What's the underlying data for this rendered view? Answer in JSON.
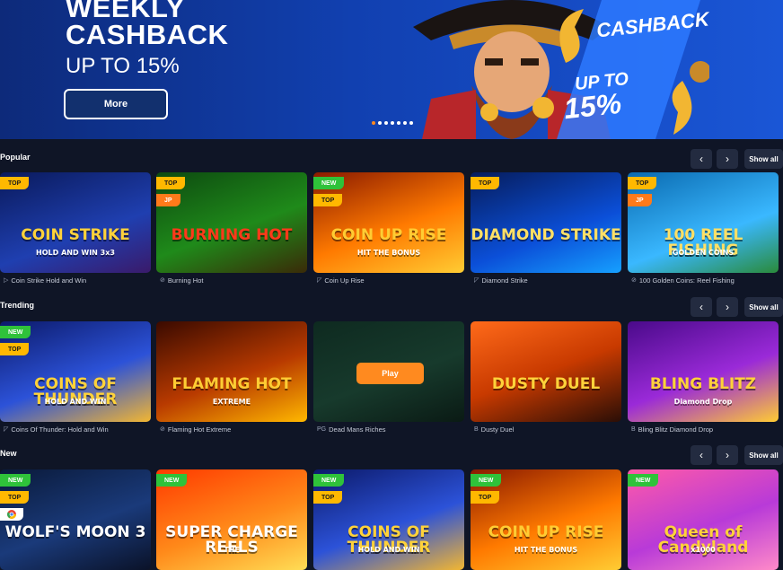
{
  "banner": {
    "title_line1": "WEEKLY",
    "title_line2": "CASHBACK",
    "subtitle": "UP TO 15%",
    "button_label": "More",
    "art_cashback": "CASHBACK",
    "art_upto": "UP TO",
    "art_percent": "15%",
    "slide_count": 7,
    "active_slide": 1
  },
  "nav": {
    "prev_icon": "‹",
    "next_icon": "›",
    "show_all": "Show all"
  },
  "sections": [
    {
      "title": "Popular",
      "games": [
        {
          "name": "Coin Strike Hold and Win",
          "logo": "COIN STRIKE",
          "logo_sub": "HOLD AND WIN 3x3",
          "badges": [
            "TOP"
          ],
          "provider_icon": "playson-icon"
        },
        {
          "name": "Burning Hot",
          "logo": "BURNING HOT",
          "logo_sub": "",
          "badges": [
            "TOP",
            "JP"
          ],
          "provider_icon": "egt-icon"
        },
        {
          "name": "Coin Up Rise",
          "logo": "COIN UP RISE",
          "logo_sub": "HIT THE BONUS",
          "badges": [
            "NEW",
            "TOP"
          ],
          "provider_icon": "3oaks-icon"
        },
        {
          "name": "Diamond Strike",
          "logo": "DIAMOND STRIKE",
          "logo_sub": "",
          "badges": [
            "TOP"
          ],
          "provider_icon": "3oaks-icon"
        },
        {
          "name": "100 Golden Coins: Reel Fishing",
          "logo": "100 REEL FISHING",
          "logo_sub": "GOLDEN COINS",
          "badges": [
            "TOP",
            "JP"
          ],
          "provider_icon": "egt-icon"
        }
      ]
    },
    {
      "title": "Trending",
      "games": [
        {
          "name": "Coins Of Thunder: Hold and Win",
          "logo": "COINS OF THUNDER",
          "logo_sub": "HOLD AND WIN",
          "badges": [
            "NEW",
            "TOP"
          ],
          "provider_icon": "3oaks-icon"
        },
        {
          "name": "Flaming Hot Extreme",
          "logo": "FLAMING HOT",
          "logo_sub": "EXTREME",
          "badges": [],
          "provider_icon": "egt-icon"
        },
        {
          "name": "Dead Mans Riches",
          "logo": "",
          "logo_sub": "",
          "badges": [],
          "provider_icon": "pg-icon",
          "play_label": "Play"
        },
        {
          "name": "Dusty Duel",
          "logo": "DUSTY DUEL",
          "logo_sub": "",
          "badges": [],
          "provider_icon": "booming-icon"
        },
        {
          "name": "Bling Blitz Diamond Drop",
          "logo": "BLING BLITZ",
          "logo_sub": "Diamond Drop",
          "badges": [],
          "provider_icon": "booming-icon"
        }
      ]
    },
    {
      "title": "New",
      "games": [
        {
          "name": "Wolf's Moon 3",
          "logo": "WOLF'S MOON 3",
          "logo_sub": "",
          "badges": [
            "NEW",
            "TOP",
            "CHROME"
          ]
        },
        {
          "name": "Super Charge the Reels",
          "logo": "SUPER CHARGE REELS",
          "logo_sub": "THE",
          "badges": [
            "NEW"
          ]
        },
        {
          "name": "Coins Of Thunder",
          "logo": "COINS OF THUNDER",
          "logo_sub": "HOLD AND WIN",
          "badges": [
            "NEW",
            "TOP"
          ]
        },
        {
          "name": "Coin Up Rise",
          "logo": "COIN UP RISE",
          "logo_sub": "HIT THE BONUS",
          "badges": [
            "NEW",
            "TOP"
          ]
        },
        {
          "name": "Queen of Candyland",
          "logo": "Queen of Candyland",
          "logo_sub": "x1000",
          "badges": [
            "NEW"
          ]
        }
      ]
    }
  ],
  "colors": {
    "page_bg": "#0f1526",
    "accent": "#ff8a1f",
    "badge_top": "#ffb800",
    "badge_new": "#2fc23a",
    "badge_jp": "#ff7a1a",
    "nav_btn": "#232b40"
  }
}
